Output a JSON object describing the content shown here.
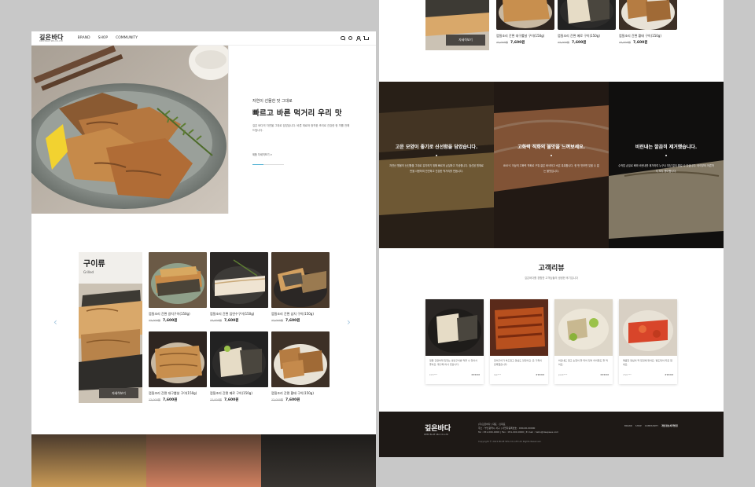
{
  "left": {
    "nav": {
      "logo": "깊은바다",
      "logo_sub": "DEEP BLUE SEA CO.,LTD",
      "links": [
        "BRAND",
        "SHOP",
        "COMMUNITY"
      ]
    },
    "hero": {
      "small": "자연이 선물한 맛 그대로",
      "title": "빠르고 바른 먹거리 우리 맛",
      "desc": "깊은 바다의 자연을 그대로 담았습니다. 바른 재료와 정직한 조리로 건강한 한 끼를 전해드립니다.",
      "link": "제품 자세히보기 >",
      "progress": 0.35
    },
    "category": {
      "title": "구이류",
      "subtitle": "Grilled",
      "button": "자세히보기"
    },
    "products": [
      {
        "name": "껍질조리 간편 갈치구이(150g)",
        "old": "12,000원",
        "price": "7,600원"
      },
      {
        "name": "껍질조리 간편 임연수구이(150g)",
        "old": "12,000원",
        "price": "7,600원"
      },
      {
        "name": "껍질조리 간편 삼치 구이(150g)",
        "old": "12,000원",
        "price": "7,600원"
      },
      {
        "name": "껍질조리 간편 대구뽈살 구이(150g)",
        "old": "12,000원",
        "price": "7,600원"
      },
      {
        "name": "껍질조리 간편 메로 구이(150g)",
        "old": "12,000원",
        "price": "7,600원"
      },
      {
        "name": "껍질조리 간편 황태 구이(150g)",
        "old": "12,000원",
        "price": "7,600원"
      }
    ]
  },
  "right": {
    "top_button": "자세히보기",
    "top_products": [
      {
        "name": "껍질조리 간편 대구뽈살 구이(150g)",
        "old": "12,000원",
        "price": "7,600원"
      },
      {
        "name": "껍질조리 간편 메로 구이(150g)",
        "old": "12,000원",
        "price": "7,600원"
      },
      {
        "name": "껍질조리 간편 황태 구이(150g)",
        "old": "12,000원",
        "price": "7,600원"
      }
    ],
    "panels": [
      {
        "title": "고운 모양이 좋기로 신선함을 담았습니다.",
        "desc": "자연산 원물의 신선함을 그대로 유지하기 위해 빠르게 손질하고 가공합니다. 엄선된 원재료만을 사용하여 안전하고 건강한 먹거리를 만듭니다."
      },
      {
        "title": "고화력 직화의 불맛을 느껴보세요.",
        "desc": "800℃ 이상의 고화력 직화로 구워 겉은 바삭하고 속은 촉촉합니다. 한 번 맛보면 잊을 수 없는 불맛입니다."
      },
      {
        "title": "비린내는 깔끔히 제거했습니다.",
        "desc": "수작업 손질로 뼈와 비린내를 제거하여 누구나 부담 없이 즐길 수 있습니다. 아이부터 어른까지 모두 좋아합니다."
      }
    ],
    "review": {
      "title": "고객리뷰",
      "subtitle": "깊은바다를 경험한 고객님들의 생생한 후기입니다",
      "cards": [
        {
          "text": "정말 간편하게 맛있는 생선구이를 먹을 수 있어서 좋아요. 재구매 의사 있습니다.",
          "user": "kim***",
          "stars": "★★★★★"
        },
        {
          "text": "장어구이가 부드럽고 양념도 맛있어요. 온 가족이 만족했습니다.",
          "user": "lee***",
          "stars": "★★★★★"
        },
        {
          "text": "비린내도 없고 손질이 잘 되어 있어 아이들도 잘 먹어요.",
          "user": "park***",
          "stars": "★★★★★"
        },
        {
          "text": "매콤한 양념이 딱 입맛에 맞아요. 밥도둑이 따로 없네요.",
          "user": "choi***",
          "stars": "★★★★★"
        }
      ]
    },
    "footer": {
      "logo": "깊은바다",
      "logo_sub": "DEEP BLUE SEA CO.,LTD",
      "info1": "(주)깊은바다 | 대표 : 김대표",
      "info2": "주소 : 부산광역시 서구 | 사업자등록번호 : 000-00-00000",
      "info3": "Tel : 051-000-0000 | Fax : 051-000-0000 | E-mail : hello@deepsea.com",
      "copy": "Copyright © 2021 BLUE SEA CO.,LTD All Rights Reserved.",
      "links": [
        "BRAND",
        "SHOP",
        "COMMUNITY",
        "개인정보처리방침"
      ]
    }
  }
}
